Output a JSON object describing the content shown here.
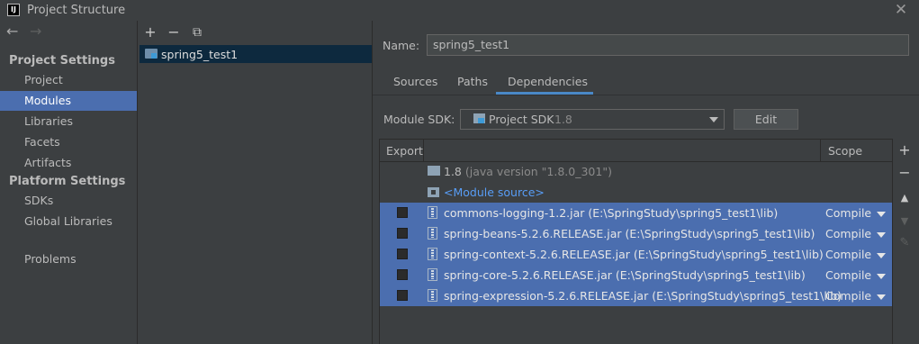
{
  "window": {
    "title": "Project Structure",
    "app_icon_text": "IJ",
    "close_glyph": "✕"
  },
  "nav": {
    "back_glyph": "←",
    "forward_glyph": "→",
    "project_settings_header": "Project Settings",
    "project_settings_items": [
      "Project",
      "Modules",
      "Libraries",
      "Facets",
      "Artifacts"
    ],
    "platform_settings_header": "Platform Settings",
    "platform_settings_items": [
      "SDKs",
      "Global Libraries"
    ],
    "problems": "Problems",
    "selected": "Modules"
  },
  "modules_panel": {
    "add_glyph": "+",
    "remove_glyph": "−",
    "copy_glyph": "⧉",
    "items": [
      "spring5_test1"
    ]
  },
  "module": {
    "name_label": "Name:",
    "name_value": "spring5_test1",
    "tabs": [
      "Sources",
      "Paths",
      "Dependencies"
    ],
    "active_tab": "Dependencies",
    "sdk_label": "Module SDK:",
    "sdk_name": "Project SDK",
    "sdk_version": "1.8",
    "edit_label": "Edit"
  },
  "deps": {
    "header_export": "Export",
    "header_scope": "Scope",
    "jdk": {
      "name": "1.8",
      "detail": "(java version \"1.8.0_301\")"
    },
    "module_source": "<Module source>",
    "rows": [
      {
        "name": "commons-logging-1.2.jar",
        "path": "(E:\\SpringStudy\\spring5_test1\\lib)",
        "scope": "Compile"
      },
      {
        "name": "spring-beans-5.2.6.RELEASE.jar",
        "path": "(E:\\SpringStudy\\spring5_test1\\lib)",
        "scope": "Compile"
      },
      {
        "name": "spring-context-5.2.6.RELEASE.jar",
        "path": "(E:\\SpringStudy\\spring5_test1\\lib)",
        "scope": "Compile"
      },
      {
        "name": "spring-core-5.2.6.RELEASE.jar",
        "path": "(E:\\SpringStudy\\spring5_test1\\lib)",
        "scope": "Compile"
      },
      {
        "name": "spring-expression-5.2.6.RELEASE.jar",
        "path": "(E:\\SpringStudy\\spring5_test1\\lib)",
        "scope": "Compile"
      }
    ],
    "actions": {
      "add_glyph": "+",
      "remove_glyph": "−",
      "up_glyph": "▲",
      "down_glyph": "▼",
      "edit_glyph": "✎"
    }
  },
  "colors": {
    "selection": "#4b6eaf",
    "background": "#3c3f41",
    "link": "#589df6",
    "tab_underline": "#4a88c7"
  }
}
